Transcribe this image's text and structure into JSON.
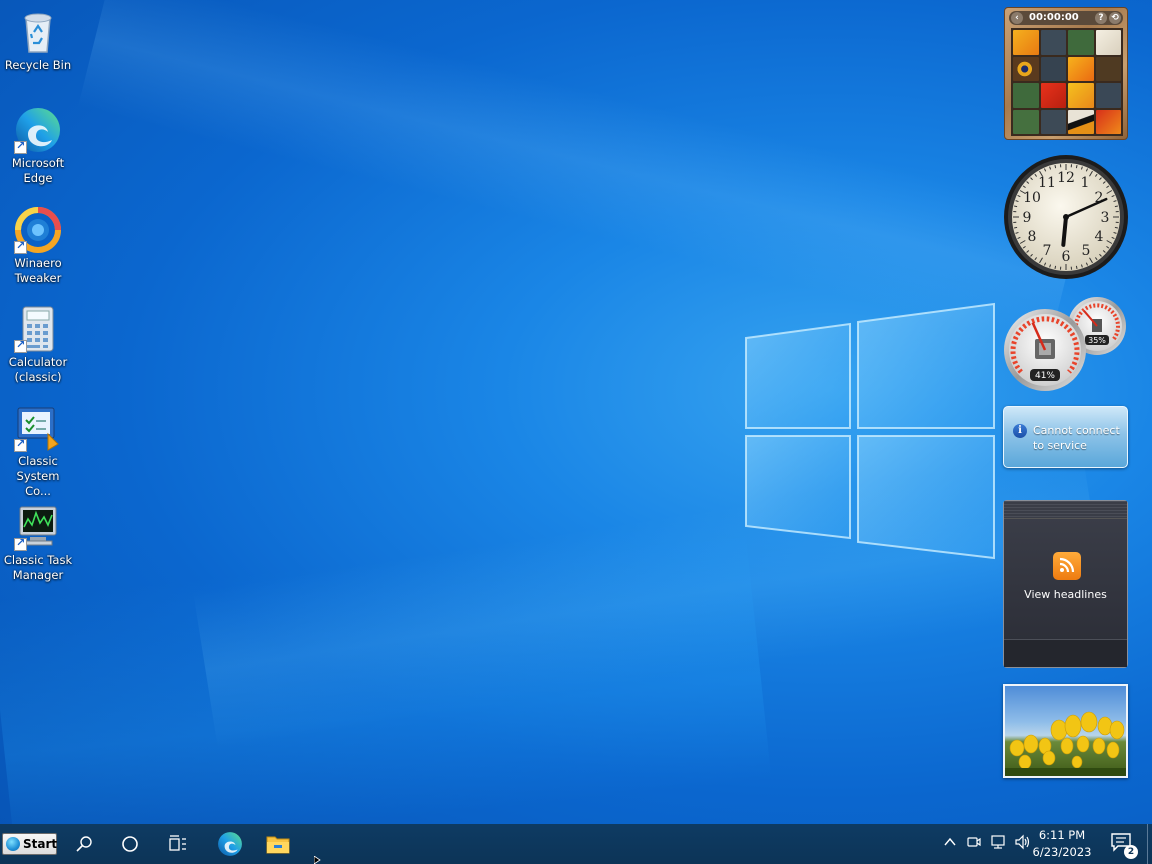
{
  "desktop": {
    "icons": [
      {
        "label": "Recycle Bin",
        "icon": "recycle-bin-icon"
      },
      {
        "label": "Microsoft Edge",
        "icon": "edge-icon"
      },
      {
        "label": "Winaero Tweaker",
        "icon": "winaero-tweaker-icon"
      },
      {
        "label": "Calculator (classic)",
        "icon": "calculator-icon"
      },
      {
        "label": "Classic System Co...",
        "icon": "system-control-icon"
      },
      {
        "label": "Classic Task Manager",
        "icon": "task-manager-icon"
      }
    ]
  },
  "gadgets": {
    "puzzle": {
      "timer": "00:00:00"
    },
    "clock": {
      "hour": 6,
      "minute": 11
    },
    "cpu_meter": {
      "cpu_label": "41%",
      "cpu_value": 41,
      "memory_label": "35%",
      "memory_value": 35
    },
    "weather": {
      "message": "Cannot connect to service"
    },
    "feed": {
      "label": "View headlines"
    },
    "slideshow": {
      "icon": "tulips-photo"
    }
  },
  "taskbar": {
    "start_label": "Start",
    "time": "6:11 PM",
    "date": "6/23/2023",
    "notification_count": "2",
    "pinned": [
      "search-icon",
      "cortana-icon",
      "task-view-icon",
      "edge-icon",
      "file-explorer-icon"
    ],
    "tray": [
      "chevron-up-icon",
      "meet-now-icon",
      "network-icon",
      "volume-icon"
    ]
  },
  "colors": {
    "desktop": "#0b67cf",
    "taskbar": "#0c3457",
    "accent": "#1a86e6"
  }
}
